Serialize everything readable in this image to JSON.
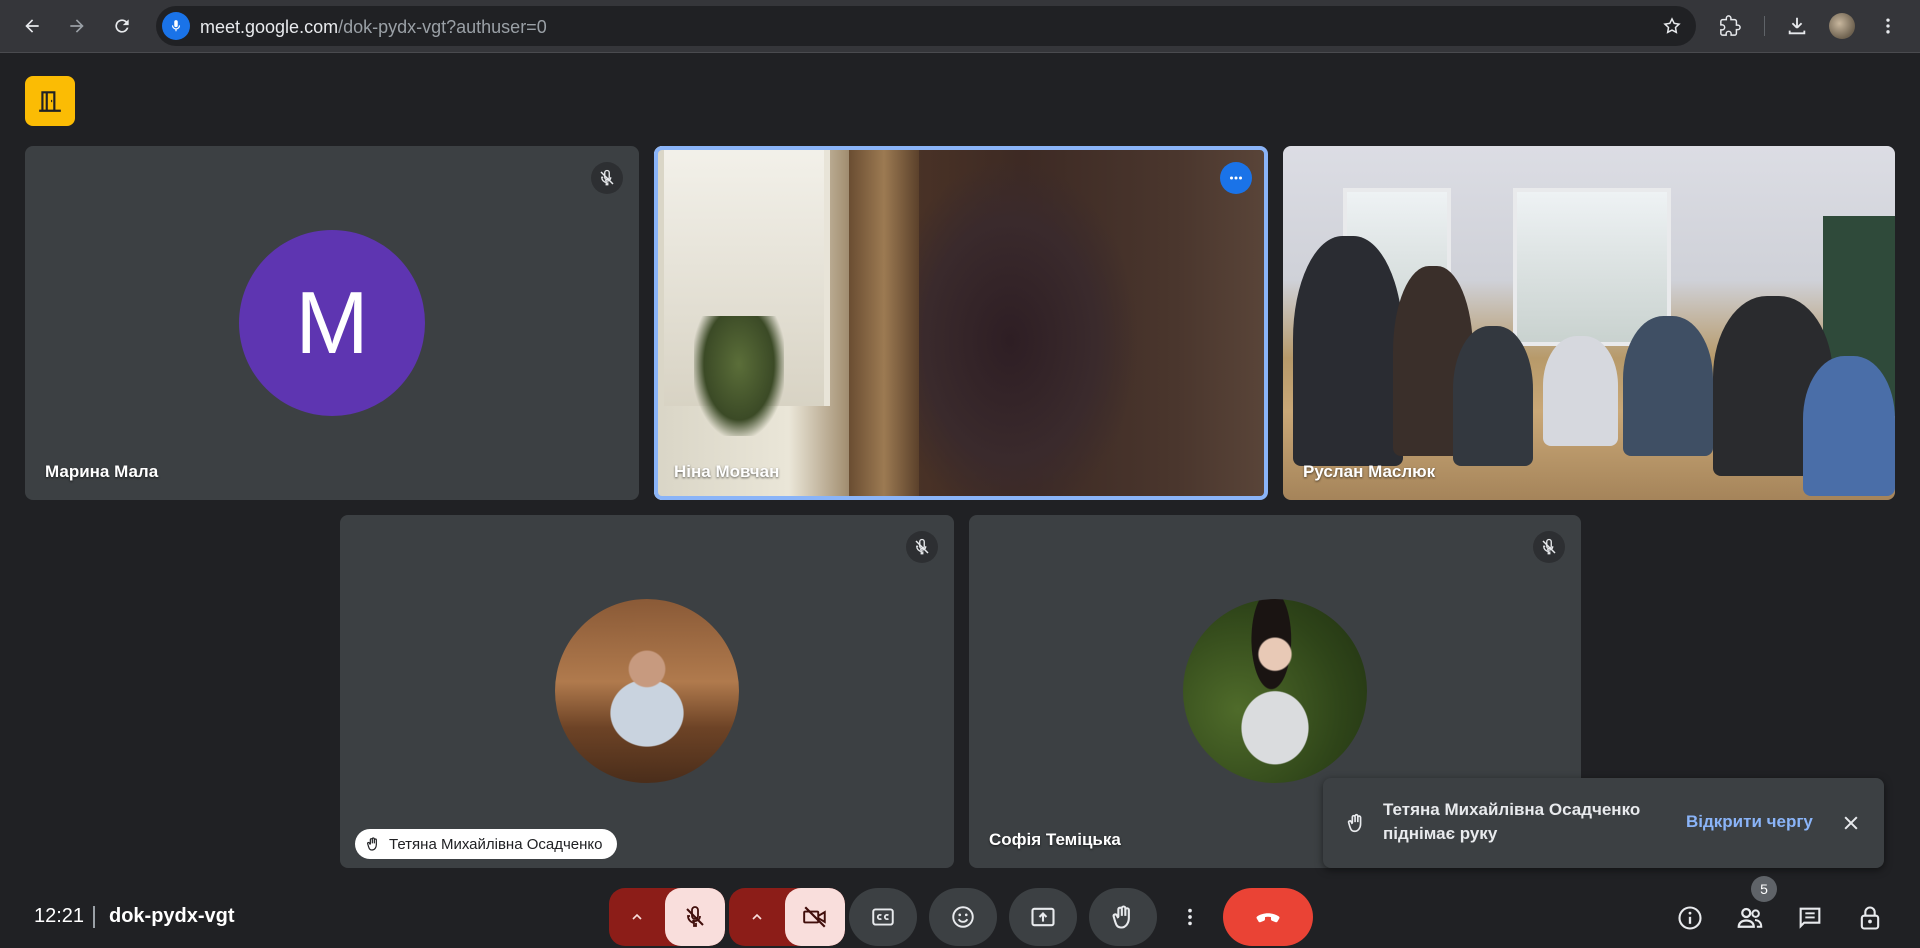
{
  "browser": {
    "url_host": "meet.google.com",
    "url_path": "/dok-pydx-vgt?authuser=0",
    "icons": [
      "back-icon",
      "forward-icon",
      "reload-icon",
      "mic-icon",
      "star-icon",
      "extensions-icon",
      "download-icon",
      "profile-avatar",
      "menu-icon"
    ]
  },
  "participants": [
    {
      "name": "Марина Мала",
      "avatar_letter": "M",
      "avatar_color": "#5e35b1",
      "muted": true
    },
    {
      "name": "Ніна Мовчан",
      "active_speaker": true,
      "muted": false
    },
    {
      "name": "Руслан Маслюк",
      "muted": false
    },
    {
      "name": "Тетяна Михайлівна Осадченко",
      "muted": true,
      "hand_raised": true
    },
    {
      "name": "Софія Теміцька",
      "muted": true
    }
  ],
  "toast": {
    "message": "Тетяна Михайлівна Осадченко піднімає руку",
    "action_label": "Відкрити чергу"
  },
  "bottom_bar": {
    "time": "12:21",
    "meeting_code": "dok-pydx-vgt",
    "people_count": "5"
  },
  "colors": {
    "background": "#202124",
    "tile": "#3c4043",
    "accent_blue": "#8ab4f8",
    "leave_red": "#ea4335",
    "muted_control": "#f9dedc",
    "companion_yellow": "#fbbc04"
  }
}
